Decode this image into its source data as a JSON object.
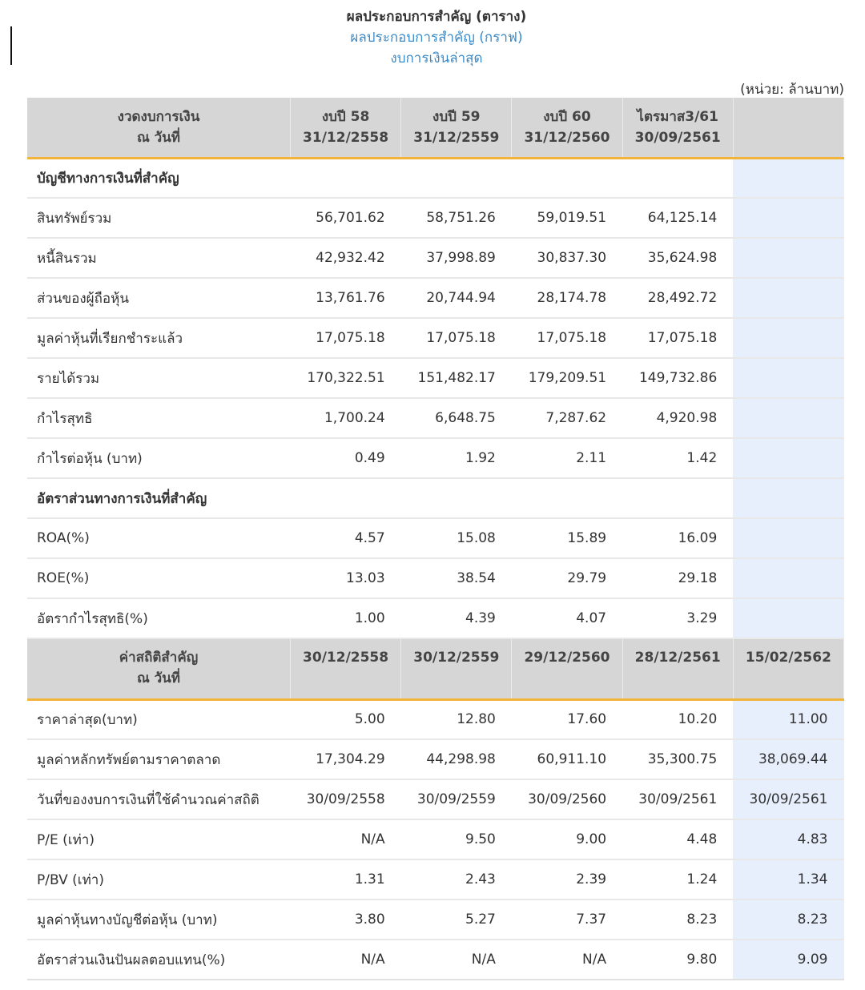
{
  "nav": {
    "active_label": "ผลประกอบการสำคัญ (ตาราง)",
    "graph_link": "ผลประกอบการสำคัญ (กราฟ)",
    "latest_link": "งบการเงินล่าสุด"
  },
  "unit_label": "(หน่วย: ล้านบาท)",
  "header1": {
    "col0": [
      "งวดงบการเงิน",
      "ณ วันที่"
    ],
    "cols": [
      [
        "งบปี 58",
        "31/12/2558"
      ],
      [
        "งบปี 59",
        "31/12/2559"
      ],
      [
        "งบปี 60",
        "31/12/2560"
      ],
      [
        "ไตรมาส3/61",
        "30/09/2561"
      ],
      [
        "",
        ""
      ]
    ]
  },
  "section1": "บัญชีทางการเงินที่สำคัญ",
  "rows1": [
    {
      "label": "สินทรัพย์รวม",
      "values": [
        "56,701.62",
        "58,751.26",
        "59,019.51",
        "64,125.14",
        ""
      ]
    },
    {
      "label": "หนี้สินรวม",
      "values": [
        "42,932.42",
        "37,998.89",
        "30,837.30",
        "35,624.98",
        ""
      ]
    },
    {
      "label": "ส่วนของผู้ถือหุ้น",
      "values": [
        "13,761.76",
        "20,744.94",
        "28,174.78",
        "28,492.72",
        ""
      ]
    },
    {
      "label": "มูลค่าหุ้นที่เรียกชำระแล้ว",
      "values": [
        "17,075.18",
        "17,075.18",
        "17,075.18",
        "17,075.18",
        ""
      ]
    },
    {
      "label": "รายได้รวม",
      "values": [
        "170,322.51",
        "151,482.17",
        "179,209.51",
        "149,732.86",
        ""
      ]
    },
    {
      "label": "กำไรสุทธิ",
      "values": [
        "1,700.24",
        "6,648.75",
        "7,287.62",
        "4,920.98",
        ""
      ]
    },
    {
      "label": "กำไรต่อหุ้น (บาท)",
      "values": [
        "0.49",
        "1.92",
        "2.11",
        "1.42",
        ""
      ]
    }
  ],
  "section2": "อัตราส่วนทางการเงินที่สำคัญ",
  "rows2": [
    {
      "label": "ROA(%)",
      "values": [
        "4.57",
        "15.08",
        "15.89",
        "16.09",
        ""
      ]
    },
    {
      "label": "ROE(%)",
      "values": [
        "13.03",
        "38.54",
        "29.79",
        "29.18",
        ""
      ]
    },
    {
      "label": "อัตรากำไรสุทธิ(%)",
      "values": [
        "1.00",
        "4.39",
        "4.07",
        "3.29",
        ""
      ]
    }
  ],
  "header2": {
    "col0": [
      "ค่าสถิติสำคัญ",
      "ณ วันที่"
    ],
    "cols": [
      "30/12/2558",
      "30/12/2559",
      "29/12/2560",
      "28/12/2561",
      "15/02/2562"
    ]
  },
  "rows3": [
    {
      "label": "ราคาล่าสุด(บาท)",
      "values": [
        "5.00",
        "12.80",
        "17.60",
        "10.20",
        "11.00"
      ]
    },
    {
      "label": "มูลค่าหลักทรัพย์ตามราคาตลาด",
      "values": [
        "17,304.29",
        "44,298.98",
        "60,911.10",
        "35,300.75",
        "38,069.44"
      ]
    },
    {
      "label": "วันที่ของงบการเงินที่ใช้คำนวณค่าสถิติ",
      "values": [
        "30/09/2558",
        "30/09/2559",
        "30/09/2560",
        "30/09/2561",
        "30/09/2561"
      ]
    },
    {
      "label": "P/E (เท่า)",
      "values": [
        "N/A",
        "9.50",
        "9.00",
        "4.48",
        "4.83"
      ]
    },
    {
      "label": "P/BV (เท่า)",
      "values": [
        "1.31",
        "2.43",
        "2.39",
        "1.24",
        "1.34"
      ]
    },
    {
      "label": "มูลค่าหุ้นทางบัญชีต่อหุ้น (บาท)",
      "values": [
        "3.80",
        "5.27",
        "7.37",
        "8.23",
        "8.23"
      ]
    },
    {
      "label": "อัตราส่วนเงินปันผลตอบแทน(%)",
      "values": [
        "N/A",
        "N/A",
        "N/A",
        "9.80",
        "9.09"
      ]
    }
  ],
  "colors": {
    "header_bg": "#d6d6d6",
    "header_underline": "#f2b43a",
    "latest_col_bg": "#e7eefc",
    "link": "#3a8ac8"
  }
}
